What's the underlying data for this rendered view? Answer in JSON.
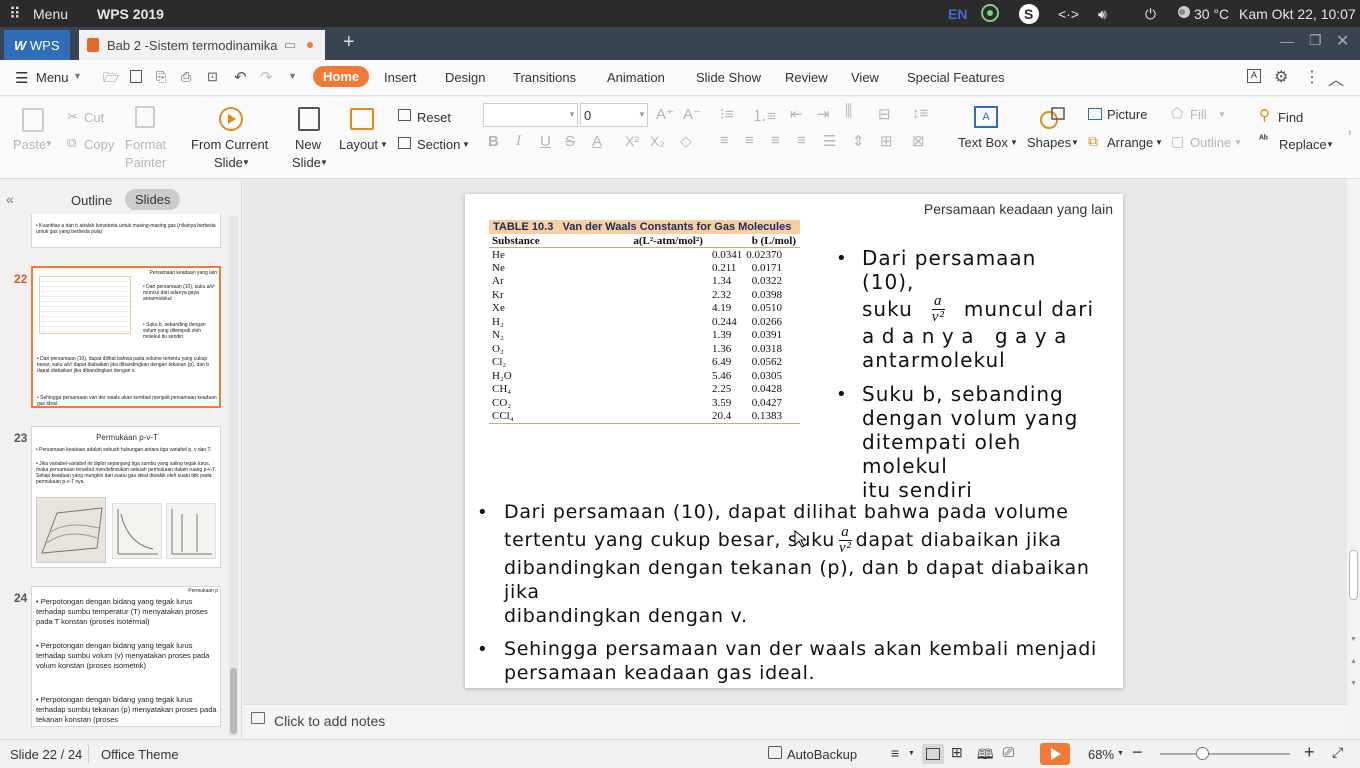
{
  "system_bar": {
    "menu_label": "Menu",
    "app_title": "WPS 2019",
    "lang": "EN",
    "temperature": "30 °C",
    "datetime": "Kam Okt 22, 10:07"
  },
  "tabbar": {
    "wps_label": "WPS",
    "doc_title": "Bab 2 -Sistem termodinamika"
  },
  "menubar": {
    "menu_label": "Menu",
    "tabs": [
      "Home",
      "Insert",
      "Design",
      "Transitions",
      "Animation",
      "Slide Show",
      "Review",
      "View",
      "Special Features"
    ],
    "active_tab": "Home"
  },
  "ribbon": {
    "paste": "Paste",
    "cut": "Cut",
    "copy": "Copy",
    "format_painter_1": "Format",
    "format_painter_2": "Painter",
    "from_current_1": "From Current",
    "from_current_2": "Slide",
    "new_slide_1": "New",
    "new_slide_2": "Slide",
    "layout": "Layout",
    "reset": "Reset",
    "section": "Section",
    "font_name": "",
    "font_size": "0",
    "text_box": "Text Box",
    "shapes": "Shapes",
    "picture": "Picture",
    "arrange": "Arrange",
    "fill": "Fill",
    "outline": "Outline",
    "find": "Find",
    "replace": "Replace"
  },
  "left_panel": {
    "tab_outline": "Outline",
    "tab_slides": "Slides",
    "slide21_text": "Kuantitas a dan b adalah konstanta untuk masing-masing gas (nilainya berbeda untuk gas yang berbeda pula)",
    "slide22": {
      "num": "22",
      "header": "Persamaan keadaan yang lain",
      "b1": "Dari persamaan (10), suku a/v² muncul dari adanya gaya antarmolekul",
      "b2": "Suku b, sebanding dengan volum yang ditempati oleh molekul itu sendiri",
      "b3": "Dari persamaan (10), dapat dilihat bahwa pada volume tertentu yang cukup besar, suku a/v² dapat diabaikan jika dibandingkan dengan tekanan (p), dan b dapat diabaikan jika dibandingkan dengan v.",
      "b4": "Sehingga persamaan van der waals akan kembali menjadi persamaan keadaan gas ideal."
    },
    "slide23": {
      "num": "23",
      "title": "Permukaan p-v-T",
      "b1": "Persamaan keadaan adalah sebuah hubungan antara tiga variabel p, v dan T.",
      "b2": "Jika variabel-variabel ini diplot sepanjang tiga sumbu yang saling tegak lurus, maka persamaan tersebut mendefinisikan sebuah permukaan dalam ruang p-v-T. Setiap keadaan yang mungkin dari suatu gas ideal diwakili oleh suatu titik pada permukaan p-v-T nya."
    },
    "slide24": {
      "num": "24",
      "header": "Permukaan p",
      "b1": "Perpotongan dengan bidang yang tegak lurus terhadap sumbu temperatur (T) menyatakan proses pada T konstan (proses isotermal)",
      "b2": "Perpotongan dengan bidang yang tegak lurus terhadap sumbu volum (v) menyatakan proses pada volum konstan (proses isometrik)",
      "b3": "Perpotongan dengan bidang yang tegak lurus terhadap sumbu tekanan (p) menyatakan proses pada tekanan konstan (proses"
    }
  },
  "slide": {
    "header": "Persamaan keadaan yang lain",
    "table": {
      "caption_num": "TABLE 10.3",
      "caption": "Van der Waals Constants for Gas Molecules",
      "col1": "Substance",
      "col2": "a(L²-atm/mol²)",
      "col3": "b (L/mol)",
      "rows": [
        [
          "He",
          "0.0341",
          "0.02370"
        ],
        [
          "Ne",
          "0.211",
          "0.0171"
        ],
        [
          "Ar",
          "1.34",
          "0.0322"
        ],
        [
          "Kr",
          "2.32",
          "0.0398"
        ],
        [
          "Xe",
          "4.19",
          "0.0510"
        ],
        [
          "H₂",
          "0.244",
          "0.0266"
        ],
        [
          "N₂",
          "1.39",
          "0.0391"
        ],
        [
          "O₂",
          "1.36",
          "0.0318"
        ],
        [
          "Cl₂",
          "6.49",
          "0.0562"
        ],
        [
          "H₂O",
          "5.46",
          "0.0305"
        ],
        [
          "CH₄",
          "2.25",
          "0.0428"
        ],
        [
          "CO₂",
          "3.59",
          "0.0427"
        ],
        [
          "CCl₄",
          "20.4",
          "0.1383"
        ]
      ]
    },
    "frac_num": "a",
    "frac_den": "v²",
    "b1_line1": "Dari persamaan (10),",
    "b1_suku": "suku",
    "b1_after": "muncul dari",
    "b1_line3": "adanya gaya",
    "b1_line4": "antarmolekul",
    "b2_line1": "Suku b, sebanding",
    "b2_line2": "dengan volum yang",
    "b2_line3": "ditempati oleh molekul",
    "b2_line4": "itu sendiri",
    "b3_line1": "Dari persamaan (10), dapat dilihat bahwa pada volume",
    "b3_line2a": "tertentu yang cukup besar, suku",
    "b3_line2b": "dapat diabaikan jika",
    "b3_line3": "dibandingkan dengan tekanan (p), dan b dapat diabaikan jika",
    "b3_line4": "dibandingkan dengan v.",
    "b4_line1": "Sehingga persamaan van der waals akan kembali menjadi",
    "b4_line2": "persamaan keadaan gas ideal."
  },
  "notes": {
    "placeholder": "Click to add notes"
  },
  "status": {
    "slide_info": "Slide 22 / 24",
    "theme": "Office Theme",
    "autobackup": "AutoBackup",
    "zoom": "68%"
  }
}
